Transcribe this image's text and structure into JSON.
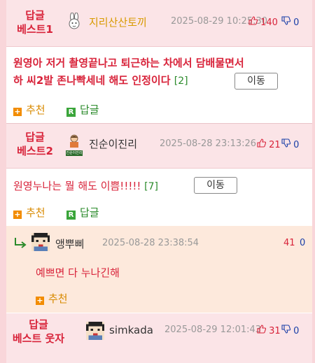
{
  "comments": [
    {
      "badge_l1": "답글",
      "badge_l2": "베스트1",
      "nick": "지리산산토끼",
      "date": "2025-08-29 10:25:30",
      "up": "140",
      "down": "0",
      "text_l1": "원영아 저거 촬영끝나고 퇴근하는 차에서 담배물면서",
      "text_l2": "하 씨2발 존나빡세네 해도 인정이다",
      "count": "[2]",
      "move": "이동",
      "recommend": "추천",
      "reply": "답글"
    },
    {
      "badge_l1": "답글",
      "badge_l2": "베스트2",
      "nick": "진순이진리",
      "date": "2025-08-28 23:13:26",
      "up": "21",
      "down": "0",
      "text": "원영누나는 뭘 해도 이쁨!!!!!",
      "count": "[7]",
      "move": "이동",
      "recommend": "추천",
      "reply": "답글",
      "avatar_label": "진순이진리"
    }
  ],
  "reply_comment": {
    "nick": "앵뿌삐",
    "date": "2025-08-28 23:38:54",
    "up": "41",
    "down": "0",
    "text": "예쁘면 다 누나긴해",
    "recommend": "추천"
  },
  "comment3": {
    "badge_l1": "답글",
    "badge_l2": "베스트 웃자",
    "nick": "simkada",
    "date": "2025-08-29 12:01:43",
    "up": "31",
    "down": "0"
  },
  "colors": {
    "accent_red": "#d8233a",
    "header_bg": "#fbe4e7",
    "reply_bg": "#fde9dc",
    "count_green": "#2a8a2a",
    "recommend_orange": "#f28c00",
    "down_blue": "#1a3fa8"
  },
  "icons": [
    "rabbit-icon",
    "thumbs-up-icon",
    "thumbs-down-icon",
    "plus-icon",
    "reply-r-icon",
    "reply-arrow-icon",
    "pixel-avatar-icon"
  ]
}
